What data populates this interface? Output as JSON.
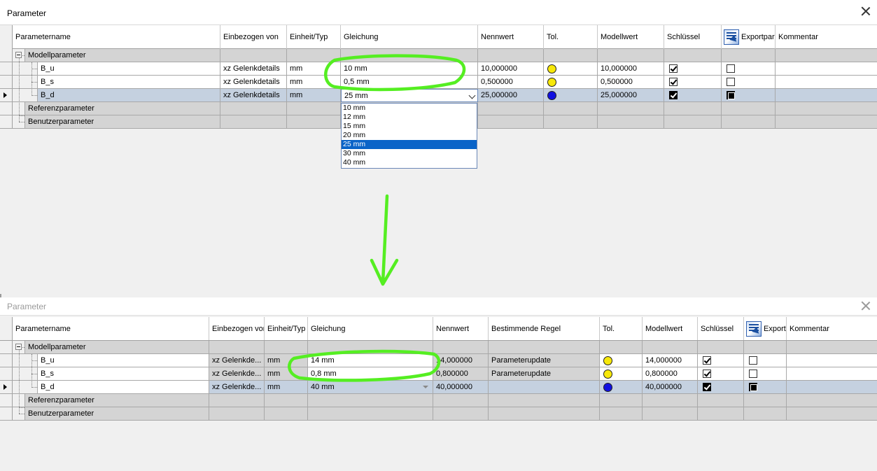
{
  "window1": {
    "title": "Parameter",
    "columns": [
      "Parametername",
      "Einbezogen von",
      "Einheit/Typ",
      "Gleichung",
      "Nennwert",
      "Tol.",
      "Modellwert",
      "Schlüssel",
      "Exportpar",
      "Kommentar"
    ],
    "groups": {
      "model": "Modellparameter",
      "reference": "Referenzparameter",
      "user": "Benutzerparameter"
    },
    "rows": [
      {
        "name": "B_u",
        "used_by": "xz Gelenkdetails",
        "unit": "mm",
        "equation": "10 mm",
        "nominal": "10,000000",
        "tol": "yellow",
        "model_value": "10,000000",
        "key": true,
        "export": false
      },
      {
        "name": "B_s",
        "used_by": "xz Gelenkdetails",
        "unit": "mm",
        "equation": "0,5 mm",
        "nominal": "0,500000",
        "tol": "yellow",
        "model_value": "0,500000",
        "key": true,
        "export": false
      },
      {
        "name": "B_d",
        "used_by": "xz Gelenkdetails",
        "unit": "mm",
        "equation": "25 mm",
        "nominal": "25,000000",
        "tol": "blue",
        "model_value": "25,000000",
        "key": true,
        "export": true
      }
    ],
    "dropdown_options": [
      "10 mm",
      "12 mm",
      "15 mm",
      "20 mm",
      "25 mm",
      "30 mm",
      "40 mm"
    ],
    "dropdown_selected": "25 mm"
  },
  "window2": {
    "title": "Parameter",
    "columns": [
      "Parametername",
      "Einbezogen von",
      "Einheit/Typ",
      "Gleichung",
      "Nennwert",
      "Bestimmende Regel",
      "Tol.",
      "Modellwert",
      "Schlüssel",
      "Export",
      "Kommentar"
    ],
    "groups": {
      "model": "Modellparameter",
      "reference": "Referenzparameter",
      "user": "Benutzerparameter"
    },
    "rows": [
      {
        "name": "B_u",
        "used_by": "xz Gelenkde...",
        "unit": "mm",
        "equation": "14 mm",
        "nominal": "14,000000",
        "rule": "Parameterupdate",
        "tol": "yellow",
        "model_value": "14,000000",
        "key": true,
        "export": false
      },
      {
        "name": "B_s",
        "used_by": "xz Gelenkde...",
        "unit": "mm",
        "equation": "0,8 mm",
        "nominal": "0,800000",
        "rule": "Parameterupdate",
        "tol": "yellow",
        "model_value": "0,800000",
        "key": true,
        "export": false
      },
      {
        "name": "B_d",
        "used_by": "xz Gelenkde...",
        "unit": "mm",
        "equation": "40 mm",
        "nominal": "40,000000",
        "rule": "",
        "tol": "blue",
        "model_value": "40,000000",
        "key": true,
        "export": true
      }
    ]
  },
  "annotations": {
    "highlight_color": "#55ee22"
  },
  "colors": {
    "selected_row": "#c5d1e0",
    "group_row": "#d4d4d4",
    "dropdown_highlight": "#0a64c8",
    "tol_yellow": "#f7e80a",
    "tol_blue": "#1010e0"
  }
}
